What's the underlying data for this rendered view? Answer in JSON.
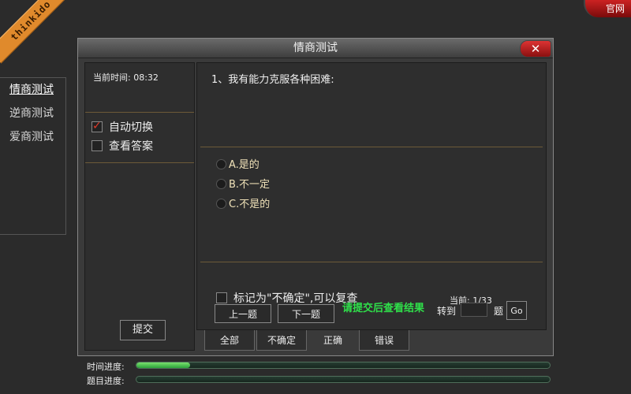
{
  "brand": {
    "ribbon_text": "thinkido",
    "official_label": "官网"
  },
  "side_nav": {
    "items": [
      {
        "label": "情商测试",
        "active": true
      },
      {
        "label": "逆商测试"
      },
      {
        "label": "爱商测试"
      }
    ]
  },
  "dialog": {
    "title": "情商测试",
    "close_glyph": "✕",
    "left": {
      "current_time": "当前时间: 08:32",
      "auto_switch": {
        "label": "自动切换",
        "checked": true
      },
      "show_answer": {
        "label": "查看答案",
        "checked": false
      },
      "submit_label": "提交"
    },
    "question": {
      "text": "1、我有能力克服各种困难:",
      "options": [
        "A.是的",
        "B.不一定",
        "C.不是的"
      ]
    },
    "mark_uncertain": {
      "label": "标记为\"不确定\",可以复查",
      "checked": false
    },
    "progress_text": "当前: 1/33",
    "nav": {
      "prev_label": "上一题",
      "next_label": "下一题",
      "hint": "请提交后查看结果",
      "goto_label": "转到",
      "goto_value": "",
      "ti_label": "题",
      "go_label": "Go"
    },
    "tabs": [
      {
        "label": "全部"
      },
      {
        "label": "不确定"
      },
      {
        "label": "正确",
        "active": true
      },
      {
        "label": "错误"
      }
    ]
  },
  "progress": {
    "time_label": "时间进度:",
    "time_fraction": 0.13,
    "question_label": "题目进度:",
    "question_fraction": 0.0
  },
  "colors": {
    "accent_green": "#2fe04a",
    "separator": "#6d5a38",
    "close_red": "#d33"
  }
}
